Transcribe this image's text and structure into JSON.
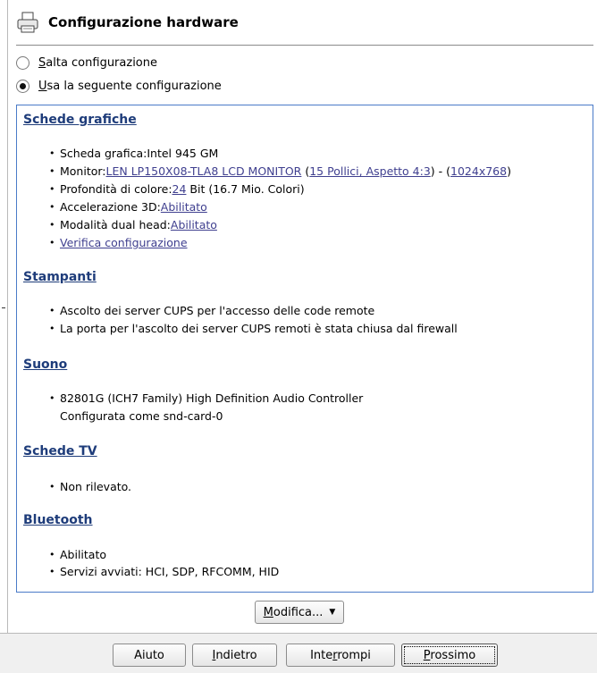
{
  "header": {
    "title": "Configurazione hardware",
    "icon": "printer-icon"
  },
  "options": {
    "skip": {
      "accel": "S",
      "rest": "alta configurazione",
      "checked": false
    },
    "use": {
      "accel": "U",
      "rest": "sa la seguente configurazione",
      "checked": true
    }
  },
  "sections": {
    "graphics": {
      "title": "Schede grafiche",
      "card": "Scheda grafica:Intel 945 GM",
      "monitor_prefix": "Monitor:",
      "monitor_link": "LEN LP150X08-TLA8 LCD MONITOR",
      "monitor_sep1": " (",
      "monitor_size_link": "15 Pollici, Aspetto 4:3",
      "monitor_sep2": ") - (",
      "monitor_res_link": "1024x768",
      "monitor_end": ")",
      "depth_prefix": "Profondità di colore:",
      "depth_link": "24",
      "depth_suffix": " Bit (16.7 Mio. Colori)",
      "accel_prefix": "Accelerazione 3D:",
      "accel_link": "Abilitato",
      "dual_prefix": "Modalità dual head:",
      "dual_link": "Abilitato",
      "verify_link": "Verifica configurazione"
    },
    "printers": {
      "title": "Stampanti",
      "items": [
        "Ascolto dei server CUPS per l'accesso delle code remote",
        "La porta per l'ascolto dei server CUPS remoti è stata chiusa dal firewall"
      ]
    },
    "sound": {
      "title": "Suono",
      "line1": "82801G (ICH7 Family) High Definition Audio Controller",
      "line2": "Configurata come snd-card-0"
    },
    "tv": {
      "title": "Schede TV",
      "items": [
        "Non rilevato."
      ]
    },
    "bluetooth": {
      "title": "Bluetooth",
      "items": [
        "Abilitato",
        "Servizi avviati: HCI, SDP, RFCOMM, HID"
      ]
    }
  },
  "buttons": {
    "modify_accel": "M",
    "modify_rest": "odifica...",
    "help": "Aiuto",
    "back_accel": "I",
    "back_rest": "ndietro",
    "abort_pre": "Inte",
    "abort_accel": "r",
    "abort_post": "rompi",
    "next_accel": "P",
    "next_rest": "rossimo"
  },
  "colors": {
    "panel_border": "#4a7bc8",
    "section_title": "#1e3c7a",
    "link": "#3f3f8f"
  }
}
